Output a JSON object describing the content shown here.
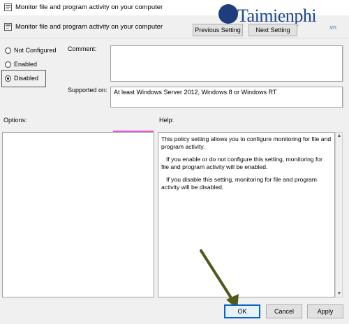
{
  "window": {
    "title": "Monitor file and program activity on your computer",
    "title_icon": "policy-icon"
  },
  "header": {
    "setting_name": "Monitor file and program activity on your computer",
    "prev_label": "Previous Setting",
    "next_label": "Next Setting"
  },
  "watermark": {
    "brand": "Taimienphi",
    "suffix": ".vn"
  },
  "state": {
    "options": [
      {
        "label": "Not Configured",
        "checked": false
      },
      {
        "label": "Enabled",
        "checked": false
      },
      {
        "label": "Disabled",
        "checked": true
      }
    ]
  },
  "comment": {
    "label": "Comment:",
    "value": ""
  },
  "supported": {
    "label": "Supported on:",
    "value": "At least Windows Server 2012, Windows 8 or Windows RT"
  },
  "options_panel": {
    "label": "Options:"
  },
  "help_panel": {
    "label": "Help:",
    "paragraphs": [
      "This policy setting allows you to configure monitoring for file and program activity.",
      "If you enable or do not configure this setting, monitoring for file and program activity will be enabled.",
      "If you disable this setting, monitoring for file and program activity will be disabled."
    ]
  },
  "footer": {
    "ok_label": "OK",
    "cancel_label": "Cancel",
    "apply_label": "Apply"
  },
  "colors": {
    "arrow": "#4d5a1c",
    "ok_border": "#0a64c8",
    "brand": "#1d4a8a"
  }
}
